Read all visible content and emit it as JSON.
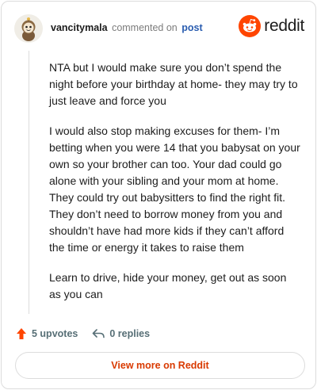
{
  "header": {
    "username": "vancitymala",
    "commented_text": "commented on",
    "post_link": "post",
    "logo_text": "reddit"
  },
  "colors": {
    "brand": "#ff4500",
    "link": "#2a5db0",
    "view_more": "#d93a00",
    "muted": "#576f76"
  },
  "comment": {
    "paragraphs": [
      "NTA but I would make sure you don’t spend the night before your birthday at home- they may try to just leave and force you",
      "I would also stop making excuses for them- I’m betting when you were 14 that you babysat on your own so your brother can too. Your dad could go alone with your sibling and your mom at home. They could try out babysitters to find the right fit. They don’t need to borrow money from you and shouldn’t have had more kids if they can’t afford the time or energy it takes to raise them",
      "Learn to drive, hide your money, get out as soon as you can"
    ]
  },
  "actions": {
    "upvotes_label": "5 upvotes",
    "replies_label": "0 replies"
  },
  "footer": {
    "view_more_label": "View more on Reddit"
  },
  "icons": {
    "avatar": "snoo-avatar-icon",
    "logo": "reddit-snoo-icon",
    "upvote": "upvote-arrow-icon",
    "reply": "reply-arrow-icon"
  }
}
